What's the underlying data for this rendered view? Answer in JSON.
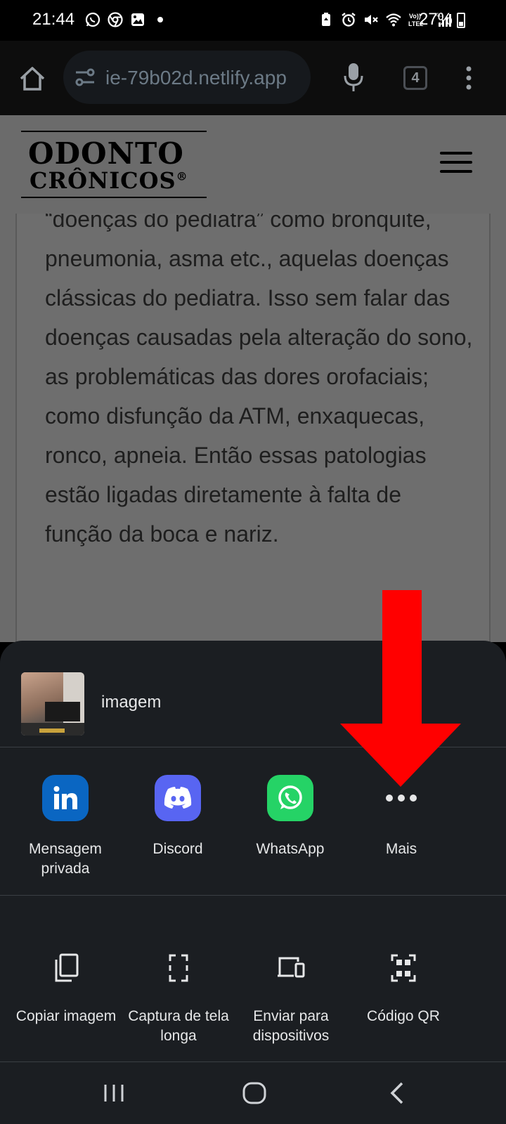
{
  "status_bar": {
    "time": "21:44",
    "battery": "27%",
    "network_label": "4G",
    "volte_label": "Vo) LTE2",
    "left_icons": [
      "whatsapp-icon",
      "chrome-icon",
      "gallery-icon",
      "dot-icon"
    ],
    "right_icons": [
      "battery-saver-icon",
      "alarm-icon",
      "mute-icon",
      "wifi-icon",
      "volte-icon",
      "signal-icon",
      "battery-icon"
    ]
  },
  "browser": {
    "url": "ie-79b02d.netlify.app",
    "tab_count": "4"
  },
  "site": {
    "logo_line1": "ODONTO",
    "logo_line2": "CRÔNICOS",
    "logo_reg": "®"
  },
  "article": {
    "text": "“doenças do pediatra” como bronquite, pneumonia, asma etc., aquelas doenças clássicas do pediatra. Isso sem falar das doenças causadas pela alteração do sono, as problemáticas das dores orofaciais; como disfunção da ATM, enxaquecas, ronco, apneia. Então essas patologias estão ligadas diretamente à falta de função da boca e nariz."
  },
  "share_sheet": {
    "title": "imagem",
    "apps": [
      {
        "label": "Mensagem privada",
        "icon": "linkedin-icon",
        "color": "#0a66c2"
      },
      {
        "label": "Discord",
        "icon": "discord-icon",
        "color": "#5865f2"
      },
      {
        "label": "WhatsApp",
        "icon": "whatsapp-icon",
        "color": "#25d366"
      },
      {
        "label": "Mais",
        "icon": "more-dots-icon",
        "color": "#1b1e22"
      }
    ],
    "actions": [
      {
        "label": "Copiar imagem",
        "icon": "copy-icon"
      },
      {
        "label": "Captura de tela longa",
        "icon": "long-screenshot-icon"
      },
      {
        "label": "Enviar para dispositivos",
        "icon": "send-to-devices-icon"
      },
      {
        "label": "Código QR",
        "icon": "qr-code-icon"
      }
    ]
  },
  "colors": {
    "sheet_bg": "#1b1e22",
    "annotation_red": "#ff0000"
  }
}
